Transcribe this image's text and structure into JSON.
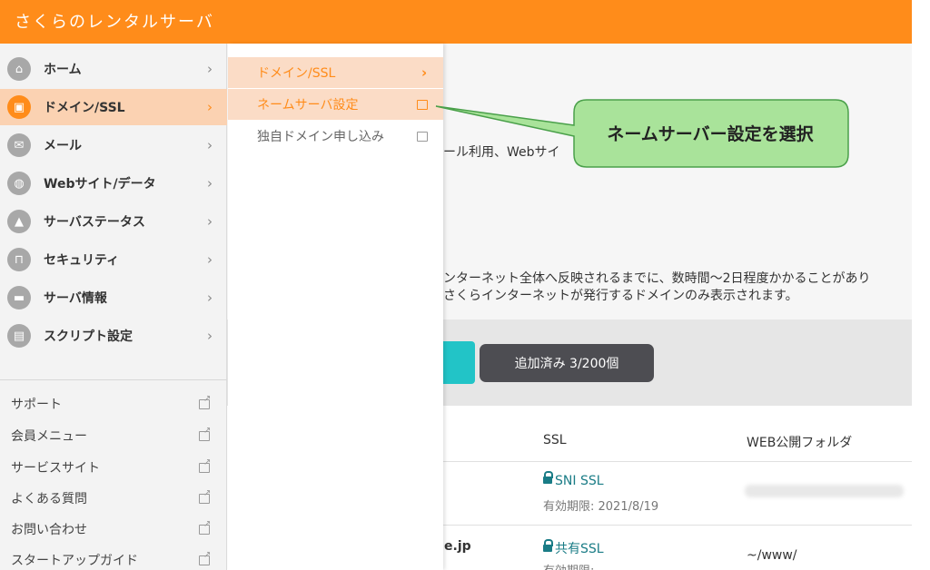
{
  "app": {
    "title": "さくらのレンタルサーバ"
  },
  "main": {
    "partial_text_1": "ール利用、Webサイ",
    "partial_text_2": "ンターネット全体へ反映されるまでに、数時間〜2日程度かかることがあり",
    "partial_text_3": "さくらインターネットが発行するドメインのみ表示されます。",
    "count_label": "追加済み 3/200個",
    "table": {
      "headers": [
        "SSL",
        "WEB公開フォルダ"
      ],
      "rows": [
        {
          "domain": "",
          "ssl": "SNI SSL",
          "expiry": "有効期限: 2021/8/19",
          "folder": ""
        },
        {
          "domain": "e.jp",
          "ssl": "共有SSL",
          "expiry": "有効期限: -",
          "folder": "~/www/"
        }
      ]
    }
  },
  "sidebar": {
    "items": [
      {
        "label": "ホーム",
        "icon": "home-icon",
        "glyph": "⌂"
      },
      {
        "label": "ドメイン/SSL",
        "icon": "domain-lock-icon",
        "glyph": "▣",
        "active": true
      },
      {
        "label": "メール",
        "icon": "mail-icon",
        "glyph": "✉"
      },
      {
        "label": "Webサイト/データ",
        "icon": "globe-icon",
        "glyph": "◍"
      },
      {
        "label": "サーバステータス",
        "icon": "chart-icon",
        "glyph": "▲"
      },
      {
        "label": "セキュリティ",
        "icon": "lock-icon",
        "glyph": "⊓"
      },
      {
        "label": "サーバ情報",
        "icon": "server-icon",
        "glyph": "▬"
      },
      {
        "label": "スクリプト設定",
        "icon": "script-icon",
        "glyph": "▤"
      }
    ],
    "chevron": "›",
    "links": [
      {
        "label": "サポート"
      },
      {
        "label": "会員メニュー"
      },
      {
        "label": "サービスサイト"
      },
      {
        "label": "よくある質問"
      },
      {
        "label": "お問い合わせ"
      },
      {
        "label": "スタートアップガイド"
      }
    ]
  },
  "flyout": {
    "header": "ドメイン/SSL",
    "chevron": "›",
    "items": [
      {
        "label": "ネームサーバ設定",
        "selected": true
      },
      {
        "label": "独自ドメイン申し込み",
        "selected": false
      }
    ]
  },
  "callout": {
    "text": "ネームサーバー設定を選択",
    "fill": "#a9e39a",
    "stroke": "#4aa04a"
  },
  "colors": {
    "brand": "#ff8c1a",
    "teal": "#22c4c7",
    "ssl": "#1a7c86"
  }
}
